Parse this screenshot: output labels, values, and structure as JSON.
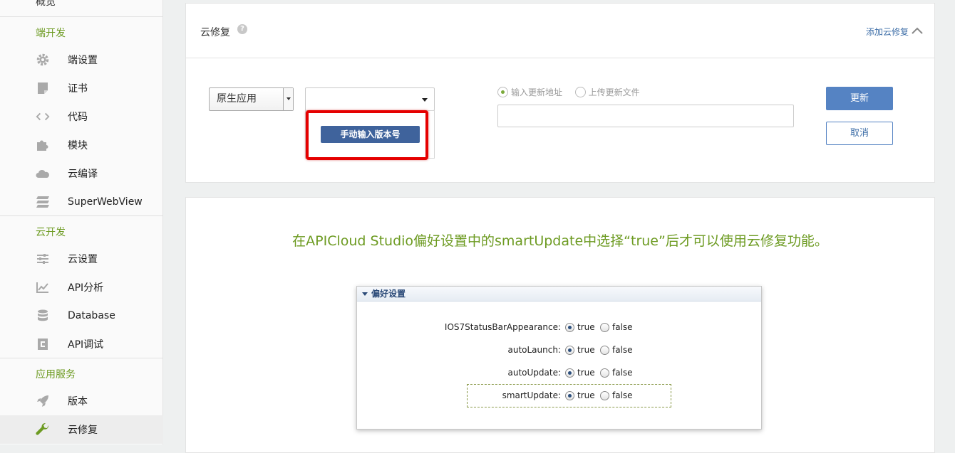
{
  "sidebar": {
    "top_item": "概览",
    "sections": [
      {
        "header": "端开发",
        "items": [
          {
            "label": "端设置",
            "icon": "gear-icon"
          },
          {
            "label": "证书",
            "icon": "certificate-icon"
          },
          {
            "label": "代码",
            "icon": "code-icon"
          },
          {
            "label": "模块",
            "icon": "puzzle-icon"
          },
          {
            "label": "云编译",
            "icon": "cloud-icon"
          },
          {
            "label": "SuperWebView",
            "icon": "layers-icon"
          }
        ]
      },
      {
        "header": "云开发",
        "items": [
          {
            "label": "云设置",
            "icon": "sliders-icon"
          },
          {
            "label": "API分析",
            "icon": "chart-icon"
          },
          {
            "label": "Database",
            "icon": "database-icon"
          },
          {
            "label": "API调试",
            "icon": "debug-icon"
          }
        ]
      },
      {
        "header": "应用服务",
        "items": [
          {
            "label": "版本",
            "icon": "rocket-icon"
          },
          {
            "label": "云修复",
            "icon": "wrench-icon",
            "active": true
          }
        ]
      }
    ]
  },
  "repair": {
    "title": "云修复",
    "help_icon": "?",
    "add_link": "添加云修复",
    "app_type_select": "原生应用",
    "version_select": "",
    "manual_button": "手动输入版本号",
    "radio_url": "输入更新地址",
    "radio_file": "上传更新文件",
    "url_input": "",
    "update_button": "更新",
    "cancel_button": "取消"
  },
  "info": {
    "notice": "在APICloud Studio偏好设置中的smartUpdate中选择“true”后才可以使用云修复功能。",
    "pref_title": "偏好设置",
    "rows": [
      {
        "key": "IOS7StatusBarAppearance:",
        "true_label": "true",
        "false_label": "false"
      },
      {
        "key": "autoLaunch:",
        "true_label": "true",
        "false_label": "false"
      },
      {
        "key": "autoUpdate:",
        "true_label": "true",
        "false_label": "false"
      },
      {
        "key": "smartUpdate:",
        "true_label": "true",
        "false_label": "false"
      }
    ]
  },
  "colors": {
    "accent_green": "#6d9b22",
    "link_blue": "#3f6fa8",
    "button_blue": "#5583c3",
    "highlight_red": "#e50000"
  }
}
